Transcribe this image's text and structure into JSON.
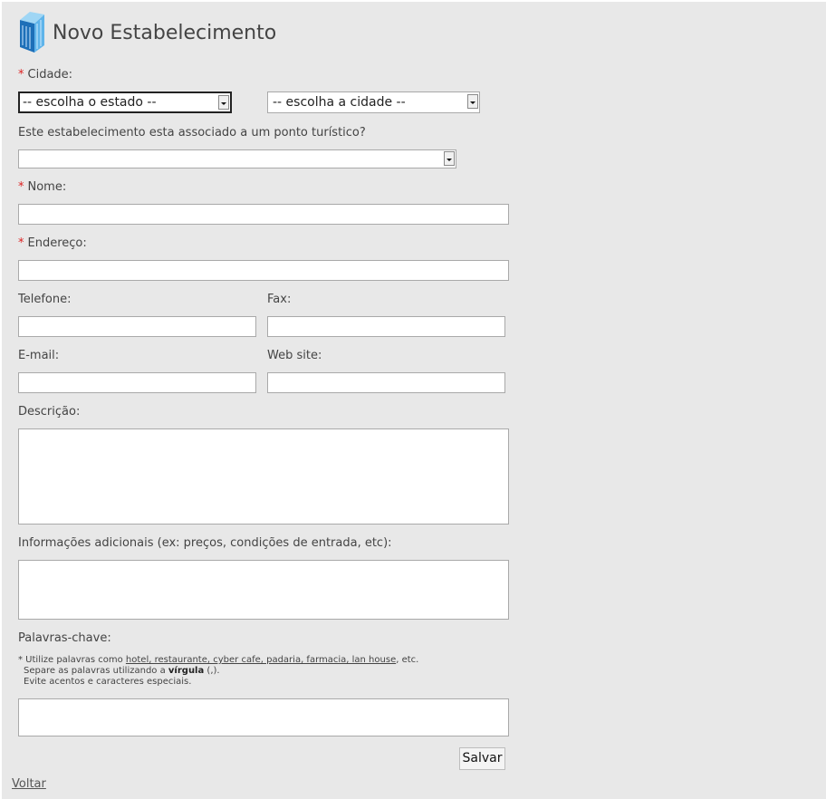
{
  "header": {
    "title": "Novo Estabelecimento",
    "icon": "building-icon"
  },
  "form": {
    "required_marker": "*",
    "cidade": {
      "label": "Cidade:",
      "estado_select": "-- escolha o estado --",
      "cidade_select": "-- escolha a cidade --"
    },
    "ponto_turistico": {
      "label": "Este estabelecimento esta associado a um ponto turístico?",
      "value": ""
    },
    "nome": {
      "label": "Nome:",
      "value": ""
    },
    "endereco": {
      "label": "Endereço:",
      "value": ""
    },
    "telefone": {
      "label": "Telefone:",
      "value": ""
    },
    "fax": {
      "label": "Fax:",
      "value": ""
    },
    "email": {
      "label": "E-mail:",
      "value": ""
    },
    "website": {
      "label": "Web site:",
      "value": ""
    },
    "descricao": {
      "label": "Descrição:",
      "value": ""
    },
    "informacoes": {
      "label": "Informações adicionais (ex: preços, condições de entrada, etc):",
      "value": ""
    },
    "palavras_chave": {
      "label": "Palavras-chave:",
      "hint_prefix": "* Utilize palavras como ",
      "hint_examples": "hotel, restaurante, cyber cafe, padaria, farmacia, lan house",
      "hint_suffix": ", etc.",
      "hint2_prefix": "Separe as palavras utilizando a ",
      "hint2_bold": "vírgula",
      "hint2_suffix": " (,).",
      "hint3": "Evite acentos e caracteres especiais.",
      "value": ""
    },
    "save_label": "Salvar"
  },
  "footer": {
    "back_link": "Voltar"
  }
}
